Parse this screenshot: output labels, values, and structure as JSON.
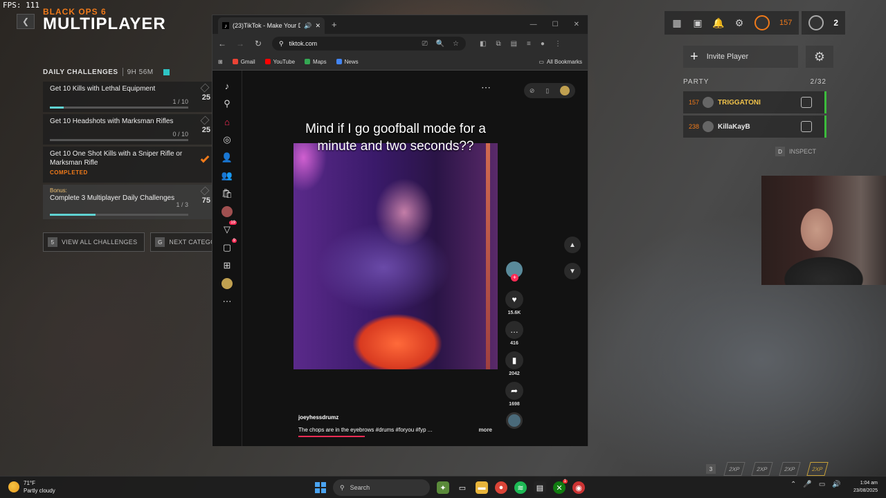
{
  "hud": {
    "fps": "FPS: 111",
    "game_subtitle": "BLACK OPS 6",
    "game_title": "MULTIPLAYER",
    "daily_challenges": {
      "title": "DAILY CHALLENGES",
      "timer": "9H 56M",
      "items": [
        {
          "name": "Get 10 Kills with Lethal Equipment",
          "progress": "1 / 10",
          "fill": 0.1,
          "xp": "25"
        },
        {
          "name": "Get 10 Headshots with Marksman Rifles",
          "progress": "0 / 10",
          "fill": 0.0,
          "xp": "25"
        },
        {
          "name": "Get 10 One Shot Kills with a Sniper Rifle or Marksman Rifle",
          "status": "COMPLETED"
        },
        {
          "bonus_label": "Bonus:",
          "name": "Complete 3 Multiplayer Daily Challenges",
          "progress": "1 / 3",
          "fill": 0.33,
          "xp": "75"
        }
      ],
      "buttons": [
        {
          "key": "5",
          "label": "VIEW ALL CHALLENGES"
        },
        {
          "key": "G",
          "label": "NEXT CATEGORY"
        }
      ]
    },
    "top_right": {
      "level": "157",
      "party_count": "2"
    },
    "invite_label": "Invite Player",
    "party": {
      "title": "PARTY",
      "count": "2/32",
      "members": [
        {
          "level": "157",
          "name": "TRIGGATONI",
          "color": "#f0c24a"
        },
        {
          "level": "238",
          "name": "KillaKayB",
          "color": "#e6e6e6"
        }
      ],
      "inspect_key": "D",
      "inspect_label": "INSPECT"
    },
    "bottom_key": "3",
    "bottom_badges": [
      "2XP",
      "2XP",
      "2XP",
      "2XP"
    ]
  },
  "browser": {
    "tab_title": "(23)TikTok - Make Your Day",
    "url": "tiktok.com",
    "bookmarks": [
      {
        "label": "Gmail",
        "color": "#ea4335"
      },
      {
        "label": "YouTube",
        "color": "#ff0000"
      },
      {
        "label": "Maps",
        "color": "#34a853"
      },
      {
        "label": "News",
        "color": "#4285f4"
      }
    ],
    "all_bookmarks": "All Bookmarks"
  },
  "tiktok": {
    "sidebar_badges": {
      "activity": "19",
      "messages": "9"
    },
    "caption": "Mind if I go goofball mode for a minute and two seconds??",
    "likes": "15.6K",
    "comments": "416",
    "saves": "2042",
    "shares": "1698",
    "username": "joeyhessdrumz",
    "description": "The chops are in the eyebrows #drums #foryou #fyp ...",
    "more": "more",
    "accent": "#fe2c55"
  },
  "taskbar": {
    "temp": "71°F",
    "weather": "Partly cloudy",
    "search": "Search",
    "xbox_badge": "1",
    "time": "1:04 am",
    "date": "23/08/2025"
  }
}
